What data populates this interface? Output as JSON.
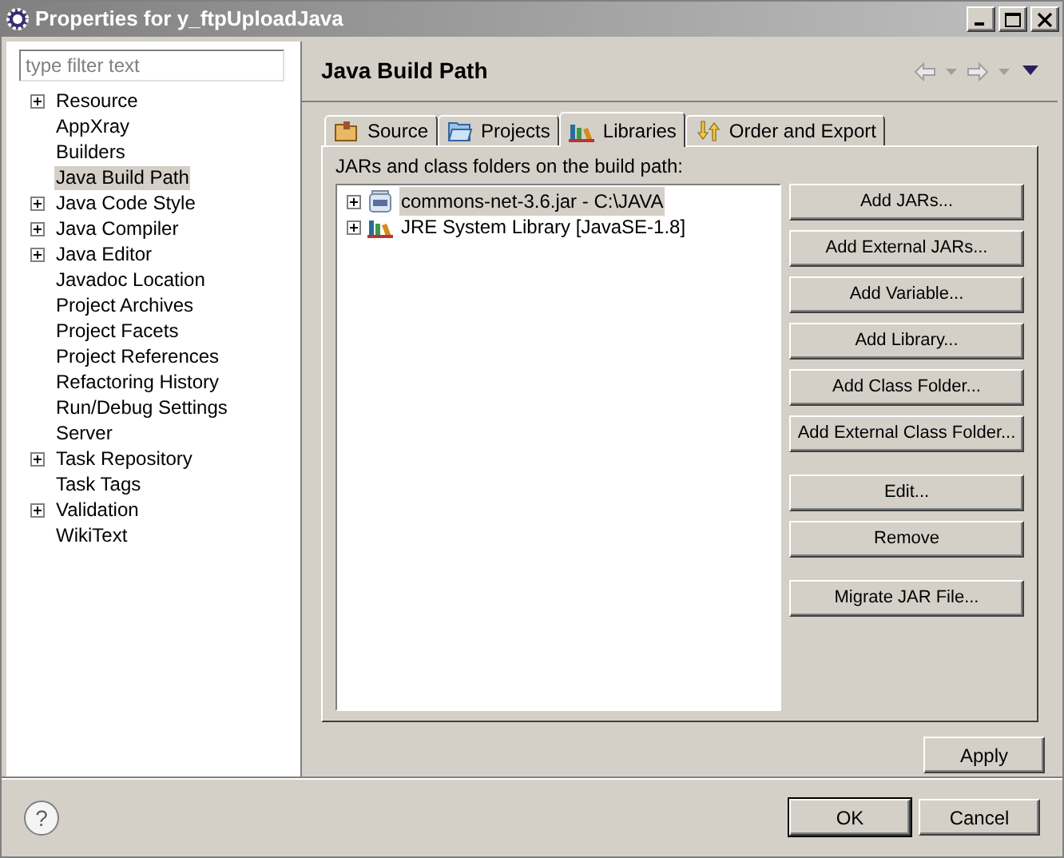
{
  "window": {
    "title": "Properties for y_ftpUploadJava"
  },
  "filter": {
    "placeholder": "type filter text"
  },
  "tree": [
    {
      "label": "Resource",
      "expandable": true,
      "selected": false
    },
    {
      "label": "AppXray",
      "expandable": false,
      "selected": false
    },
    {
      "label": "Builders",
      "expandable": false,
      "selected": false
    },
    {
      "label": "Java Build Path",
      "expandable": false,
      "selected": true
    },
    {
      "label": "Java Code Style",
      "expandable": true,
      "selected": false
    },
    {
      "label": "Java Compiler",
      "expandable": true,
      "selected": false
    },
    {
      "label": "Java Editor",
      "expandable": true,
      "selected": false
    },
    {
      "label": "Javadoc Location",
      "expandable": false,
      "selected": false
    },
    {
      "label": "Project Archives",
      "expandable": false,
      "selected": false
    },
    {
      "label": "Project Facets",
      "expandable": false,
      "selected": false
    },
    {
      "label": "Project References",
      "expandable": false,
      "selected": false
    },
    {
      "label": "Refactoring History",
      "expandable": false,
      "selected": false
    },
    {
      "label": "Run/Debug Settings",
      "expandable": false,
      "selected": false
    },
    {
      "label": "Server",
      "expandable": false,
      "selected": false
    },
    {
      "label": "Task Repository",
      "expandable": true,
      "selected": false
    },
    {
      "label": "Task Tags",
      "expandable": false,
      "selected": false
    },
    {
      "label": "Validation",
      "expandable": true,
      "selected": false
    },
    {
      "label": "WikiText",
      "expandable": false,
      "selected": false
    }
  ],
  "page": {
    "title": "Java Build Path"
  },
  "tabs": [
    {
      "label": "Source",
      "kind": "source",
      "selected": false
    },
    {
      "label": "Projects",
      "kind": "projects",
      "selected": false
    },
    {
      "label": "Libraries",
      "kind": "libraries",
      "selected": true
    },
    {
      "label": "Order and Export",
      "kind": "order",
      "selected": false
    }
  ],
  "list_label": "JARs and class folders on the build path:",
  "entries": [
    {
      "label": "commons-net-3.6.jar - C:\\JAVA",
      "kind": "jar",
      "selected": true
    },
    {
      "label": "JRE System Library [JavaSE-1.8]",
      "kind": "library",
      "selected": false
    }
  ],
  "button_groups": [
    [
      "Add JARs...",
      "Add External JARs...",
      "Add Variable...",
      "Add Library...",
      "Add Class Folder...",
      "Add External Class Folder..."
    ],
    [
      "Edit...",
      "Remove"
    ],
    [
      "Migrate JAR File..."
    ]
  ],
  "apply": "Apply",
  "help": "?",
  "footer_buttons": [
    {
      "label": "OK",
      "default": true
    },
    {
      "label": "Cancel",
      "default": false
    }
  ]
}
